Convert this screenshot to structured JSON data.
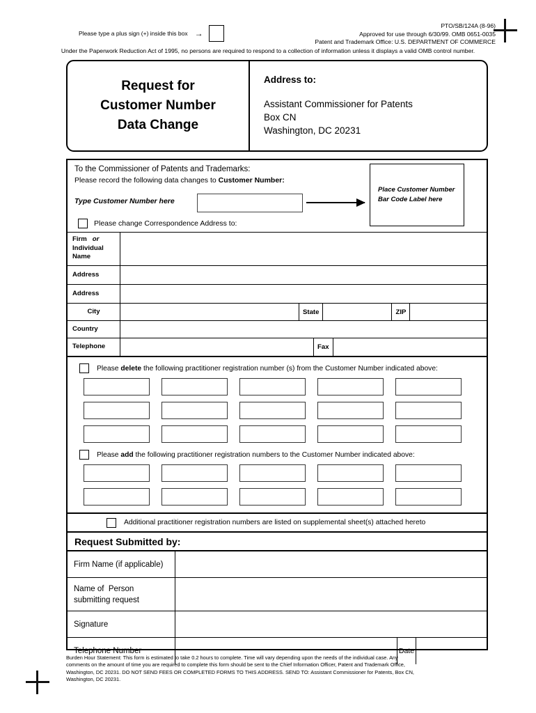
{
  "top_meta": {
    "plus_instruction": "Please type a plus sign (+) inside this box",
    "arrow_glyph": "→",
    "form_number": "PTO/SB/124A   (8-96)",
    "approved_line": "Approved for use through 6/30/99.   OMB 0651-0035",
    "office_line": "Patent and Trademark Office: U.S. DEPARTMENT OF COMMERCE",
    "paperwork_line": "Under the Paperwork Reduction Act of 1995, no persons are required to respond to a collection of information unless it displays a valid OMB control number."
  },
  "header": {
    "title_line1": "Request for",
    "title_line2": "Customer Number",
    "title_line3": "Data Change",
    "address_to_label": "Address to:",
    "address_line1": "Assistant Commissioner for Patents",
    "address_line2": "Box  CN",
    "address_line3": "Washington, DC   20231"
  },
  "commissioner": {
    "line1": "To the Commissioner of Patents and Trademarks:",
    "line2_prefix": "Please record the following data changes to ",
    "line2_bold": "Customer Number:",
    "type_here_label": "Type Customer Number here",
    "customer_number_value": "",
    "change_address_label": "Please change Correspondence Address to:",
    "barcode_line1": "Place Customer Number",
    "barcode_line2": "Bar Code Label here"
  },
  "address_table": {
    "rows": [
      {
        "label": "Firm   or\nIndividual\nName",
        "value": ""
      },
      {
        "label": "Address",
        "value": ""
      },
      {
        "label": "Address",
        "value": ""
      },
      {
        "label": "City",
        "value": ""
      },
      {
        "label": "Country",
        "value": ""
      },
      {
        "label": "Telephone",
        "value": ""
      }
    ],
    "state_label": "State",
    "state_value": "",
    "zip_label": "ZIP",
    "zip_value": "",
    "fax_label": "Fax",
    "fax_value": ""
  },
  "delete_section": {
    "text_prefix": "Please ",
    "text_bold": "delete",
    "text_suffix": " the following practitioner registration number (s) from the Customer Number indicated above:",
    "rows": [
      [
        "",
        "",
        "",
        "",
        ""
      ],
      [
        "",
        "",
        "",
        "",
        ""
      ],
      [
        "",
        "",
        "",
        "",
        ""
      ]
    ]
  },
  "add_section": {
    "text_prefix": "Please ",
    "text_bold": "add",
    "text_suffix": " the following  practitioner registration numbers to the Customer Number indicated above:",
    "rows": [
      [
        "",
        "",
        "",
        "",
        ""
      ],
      [
        "",
        "",
        "",
        "",
        ""
      ]
    ]
  },
  "supplemental": {
    "label": "Additional practitioner registration numbers are listed on supplemental sheet(s) attached hereto"
  },
  "submitted_by": {
    "heading": "Request Submitted by:",
    "firm_name_label": "Firm Name (if applicable)",
    "firm_name_value": "",
    "person_label": "Name of  Person\nsubmitting request",
    "person_value": "",
    "signature_label": "Signature",
    "signature_value": "",
    "telephone_label": "Telephone Number",
    "telephone_value": "",
    "date_label": "Date",
    "date_value": ""
  },
  "burden": {
    "line1": "Burden Hour Statement: This form is estimated to take 0.2 hours to complete.   Time will vary depending upon the needs of the individual case.   Any",
    "line2": "comments on the amount of time you are required to complete this form should be sent to the Chief Information Officer, Patent and Trademark Office,",
    "line3": "Washington, DC 20231.    DO NOT SEND FEES OR COMPLETED FORMS TO THIS ADDRESS.  SEND TO:  Assistant Commissioner for Patents, Box CN,",
    "line4": "Washington, DC 20231."
  }
}
